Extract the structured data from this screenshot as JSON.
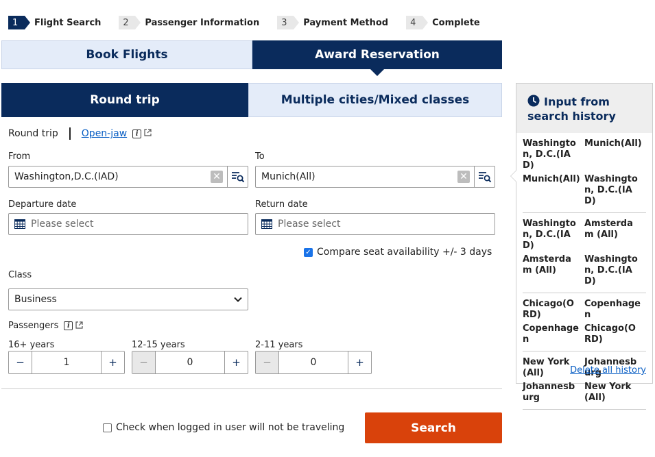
{
  "steps": [
    {
      "num": "1",
      "label": "Flight Search"
    },
    {
      "num": "2",
      "label": "Passenger Information"
    },
    {
      "num": "3",
      "label": "Payment Method"
    },
    {
      "num": "4",
      "label": "Complete"
    }
  ],
  "top_tabs": {
    "book": "Book Flights",
    "award": "Award Reservation"
  },
  "sub_tabs": {
    "round": "Round trip",
    "multi": "Multiple cities/Mixed classes"
  },
  "trip_type": {
    "current": "Round trip",
    "open_jaw": "Open-jaw"
  },
  "from": {
    "label": "From",
    "value": "Washington,D.C.(IAD)"
  },
  "to": {
    "label": "To",
    "value": "Munich(All)"
  },
  "departure": {
    "label": "Departure date",
    "placeholder": "Please select"
  },
  "return": {
    "label": "Return date",
    "placeholder": "Please select"
  },
  "compare_label": "Compare seat availability +/- 3 days",
  "class": {
    "label": "Class",
    "value": "Business"
  },
  "passengers": {
    "label": "Passengers",
    "groups": [
      {
        "label": "16+ years",
        "value": "1"
      },
      {
        "label": "12-15 years",
        "value": "0"
      },
      {
        "label": "2-11 years",
        "value": "0"
      }
    ]
  },
  "not_traveling_label": "Check when logged in user will not be traveling",
  "search_label": "Search",
  "history": {
    "title": "Input from search history",
    "groups": [
      [
        [
          "Washington, D.C.(IAD)",
          "Munich(All)"
        ],
        [
          "Munich(All)",
          "Washington, D.C.(IAD)"
        ]
      ],
      [
        [
          "Washington, D.C.(IAD)",
          "Amsterdam (All)"
        ],
        [
          "Amsterdam (All)",
          "Washington, D.C.(IAD)"
        ]
      ],
      [
        [
          "Chicago(ORD)",
          "Copenhagen"
        ],
        [
          "Copenhagen",
          "Chicago(ORD)"
        ]
      ],
      [
        [
          "New York(All)",
          "Johannesburg"
        ],
        [
          "Johannesburg",
          "New York(All)"
        ]
      ]
    ],
    "delete_all": "Delete all history"
  },
  "colors": {
    "navy": "#0a2b5c",
    "light_tab": "#e4ecf9",
    "search": "#d9420b",
    "link": "#0a5fc4"
  }
}
